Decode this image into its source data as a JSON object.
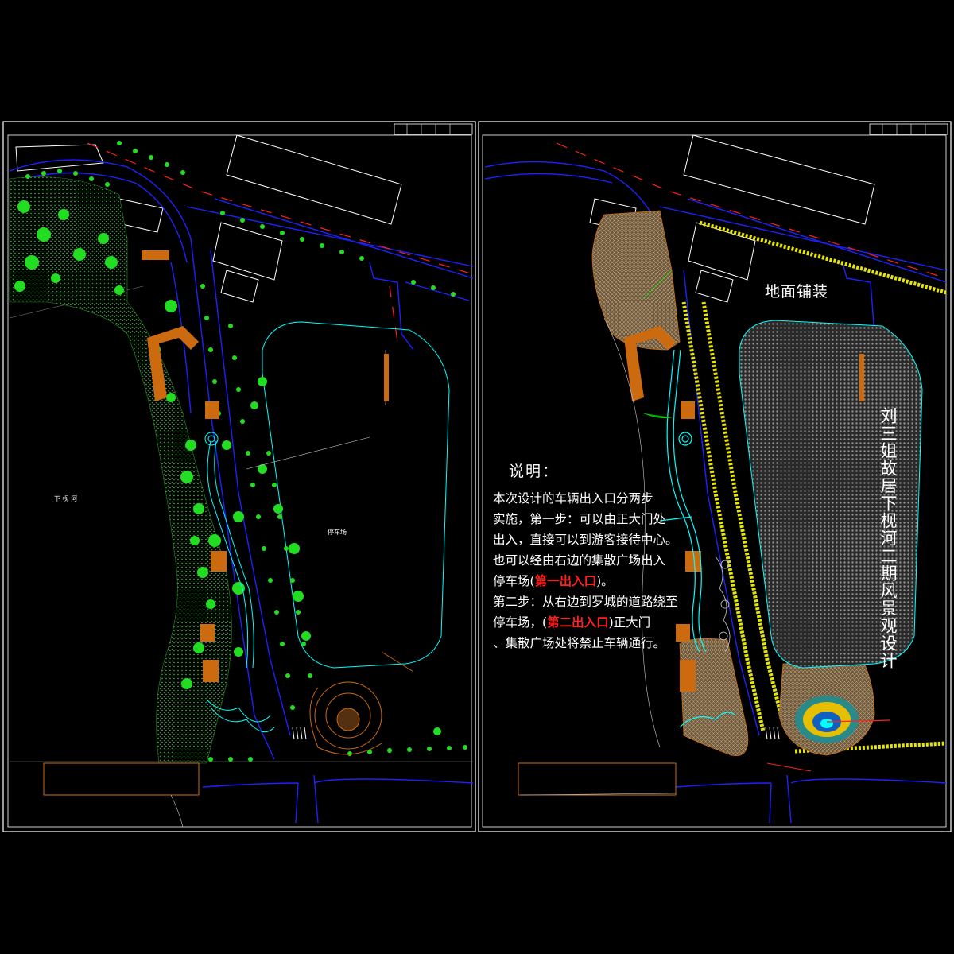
{
  "notes": {
    "title": "说明：",
    "line1": "本次设计的车辆出入口分两步",
    "line2": "实施，第一步：可以由正大门处",
    "line3": "出入，直接可以到游客接待中心。",
    "line4": "也可以经由右边的集散广场出入",
    "line5_pre": "停车场(",
    "line5_red": "第一出入口",
    "line5_post": ")。",
    "line6": "第二步：从右边到罗城的道路绕至",
    "line7_pre": "停车场，(",
    "line7_red": "第二出入口",
    "line7_post": ")正大门",
    "line8": "、集散广场处将禁止车辆通行。"
  },
  "labels": {
    "ground_paving": "地面铺装",
    "project_title": "刘三姐故居下枧河二期风景观设计",
    "river": "下 枧 河",
    "parking_lot": "停车场"
  },
  "colors": {
    "background": "#000000",
    "frame": "#ffffff",
    "road": "#0000ff",
    "cyan": "#00ffff",
    "tree_green": "#22dd22",
    "building_orange": "#cc6a10",
    "accent_red": "#ff2020",
    "yellow": "#e6e600",
    "paving_tan": "#a08050"
  }
}
